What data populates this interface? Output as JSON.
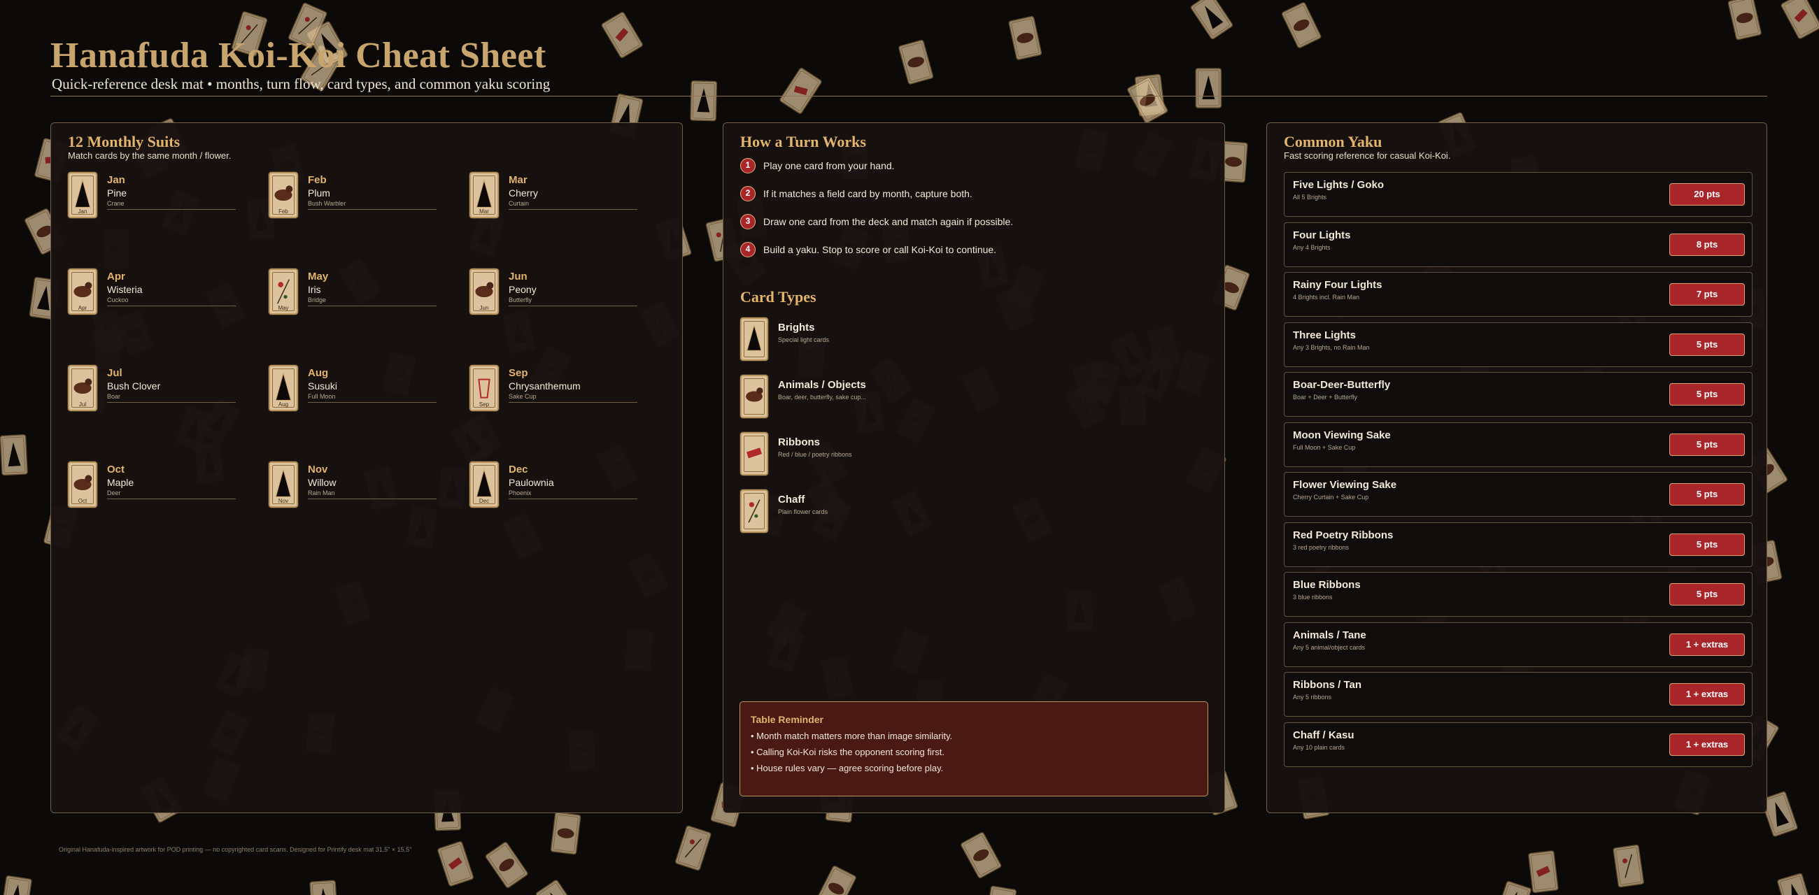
{
  "header": {
    "title": "Hanafuda Koi-Koi Cheat Sheet",
    "subtitle": "Quick-reference desk mat • months, turn flow, card types, and common yaku scoring"
  },
  "suits_panel": {
    "title": "12 Monthly Suits",
    "desc": "Match cards by the same month / flower.",
    "suits": [
      {
        "month": "Jan",
        "flower": "Pine",
        "sub": "Crane",
        "icon": "bright-triangle-icon"
      },
      {
        "month": "Feb",
        "flower": "Plum",
        "sub": "Bush Warbler",
        "icon": "animal-oval-icon"
      },
      {
        "month": "Mar",
        "flower": "Cherry",
        "sub": "Curtain",
        "icon": "bright-triangle-icon"
      },
      {
        "month": "Apr",
        "flower": "Wisteria",
        "sub": "Cuckoo",
        "icon": "animal-oval-icon"
      },
      {
        "month": "May",
        "flower": "Iris",
        "sub": "Bridge",
        "icon": "chaff-branch-icon"
      },
      {
        "month": "Jun",
        "flower": "Peony",
        "sub": "Butterfly",
        "icon": "animal-oval-icon"
      },
      {
        "month": "Jul",
        "flower": "Bush Clover",
        "sub": "Boar",
        "icon": "animal-oval-icon"
      },
      {
        "month": "Aug",
        "flower": "Susuki",
        "sub": "Full Moon",
        "icon": "bright-triangle-icon"
      },
      {
        "month": "Sep",
        "flower": "Chrysanthemum",
        "sub": "Sake Cup",
        "icon": "sake-cup-icon"
      },
      {
        "month": "Oct",
        "flower": "Maple",
        "sub": "Deer",
        "icon": "animal-oval-icon"
      },
      {
        "month": "Nov",
        "flower": "Willow",
        "sub": "Rain Man",
        "icon": "bright-triangle-icon"
      },
      {
        "month": "Dec",
        "flower": "Paulownia",
        "sub": "Phoenix",
        "icon": "bright-triangle-icon"
      }
    ]
  },
  "turn_panel": {
    "title": "How a Turn Works",
    "steps": [
      {
        "num": "1",
        "text": "Play one card from your hand."
      },
      {
        "num": "2",
        "text": "If it matches a field card by month, capture both."
      },
      {
        "num": "3",
        "text": "Draw one card from the deck and match again if possible."
      },
      {
        "num": "4",
        "text": "Build a yaku. Stop to score or call Koi-Koi to continue."
      }
    ],
    "types_title": "Card Types",
    "types": [
      {
        "name": "Brights",
        "desc": "Special light cards",
        "icon": "bright-triangle-icon"
      },
      {
        "name": "Animals / Objects",
        "desc": "Boar, deer, butterfly, sake cup...",
        "icon": "animal-oval-icon"
      },
      {
        "name": "Ribbons",
        "desc": "Red / blue / poetry ribbons",
        "icon": "ribbon-icon"
      },
      {
        "name": "Chaff",
        "desc": "Plain flower cards",
        "icon": "chaff-branch-icon"
      }
    ],
    "reminder": {
      "title": "Table Reminder",
      "items": [
        "• Month match matters more than image similarity.",
        "• Calling Koi-Koi risks the opponent scoring first.",
        "• House rules vary — agree scoring before play."
      ]
    }
  },
  "yaku_panel": {
    "title": "Common Yaku",
    "desc": "Fast scoring reference for casual Koi-Koi.",
    "items": [
      {
        "name": "Five Lights / Goko",
        "desc": "All 5 Brights",
        "pts": "20 pts"
      },
      {
        "name": "Four Lights",
        "desc": "Any 4 Brights",
        "pts": "8 pts"
      },
      {
        "name": "Rainy Four Lights",
        "desc": "4 Brights incl. Rain Man",
        "pts": "7 pts"
      },
      {
        "name": "Three Lights",
        "desc": "Any 3 Brights, no Rain Man",
        "pts": "5 pts"
      },
      {
        "name": "Boar-Deer-Butterfly",
        "desc": "Boar + Deer + Butterfly",
        "pts": "5 pts"
      },
      {
        "name": "Moon Viewing Sake",
        "desc": "Full Moon + Sake Cup",
        "pts": "5 pts"
      },
      {
        "name": "Flower Viewing Sake",
        "desc": "Cherry Curtain + Sake Cup",
        "pts": "5 pts"
      },
      {
        "name": "Red Poetry Ribbons",
        "desc": "3 red poetry ribbons",
        "pts": "5 pts"
      },
      {
        "name": "Blue Ribbons",
        "desc": "3 blue ribbons",
        "pts": "5 pts"
      },
      {
        "name": "Animals / Tane",
        "desc": "Any 5 animal/object cards",
        "pts": "1 + extras"
      },
      {
        "name": "Ribbons / Tan",
        "desc": "Any 5 ribbons",
        "pts": "1 + extras"
      },
      {
        "name": "Chaff / Kasu",
        "desc": "Any 10 plain cards",
        "pts": "1 + extras"
      }
    ]
  },
  "footer": {
    "text": "Original Hanafuda-inspired artwork for POD printing — no copyrighted card scans. Designed for Printify desk mat 31.5\" × 15.5\""
  },
  "colors": {
    "background": "#0c0a09",
    "panel": "#17110f",
    "gold": "#c9a56e",
    "accent_red": "#a8262a",
    "card": "#dcc39d"
  }
}
